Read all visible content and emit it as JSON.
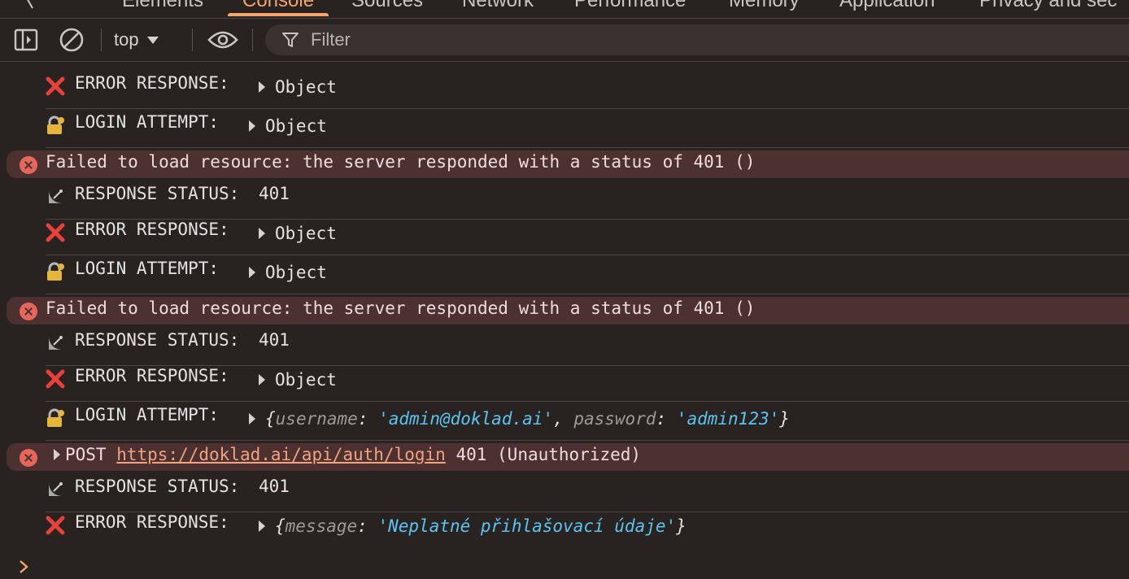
{
  "tabs": [
    {
      "label": "Elements"
    },
    {
      "label": "Console"
    },
    {
      "label": "Sources"
    },
    {
      "label": "Network"
    },
    {
      "label": "Performance"
    },
    {
      "label": "Memory"
    },
    {
      "label": "Application"
    },
    {
      "label": "Privacy and sec"
    }
  ],
  "active_tab": "Console",
  "toolbar": {
    "context": "top",
    "filter_placeholder": "Filter"
  },
  "icons": {
    "sidebar": "sidebar-toggle-icon",
    "clear": "clear-console-icon",
    "eye": "live-expression-eye-icon",
    "filter": "filter-funnel-icon",
    "error": "error-circle-x-icon",
    "cross": "cross-mark-emoji",
    "lock": "lock-with-key-emoji",
    "satellite": "satellite-dish-emoji",
    "prompt": "prompt-chevron-icon"
  },
  "colors": {
    "accent": "#f5a46e",
    "error_bg": "#4d3131",
    "number": "#9a8cf7",
    "string": "#5cc4f0"
  },
  "logs": {
    "r1": {
      "label": "ERROR RESPONSE:",
      "value": "Object"
    },
    "r2": {
      "label": "LOGIN ATTEMPT:",
      "value": "Object"
    },
    "e1": {
      "text": "Failed to load resource: the server responded with a status of 401 ()"
    },
    "r3": {
      "label": "RESPONSE STATUS:",
      "value": "401"
    },
    "r4": {
      "label": "ERROR RESPONSE:",
      "value": "Object"
    },
    "r5": {
      "label": "LOGIN ATTEMPT:",
      "value": "Object"
    },
    "e2": {
      "text": "Failed to load resource: the server responded with a status of 401 ()"
    },
    "r6": {
      "label": "RESPONSE STATUS:",
      "value": "401"
    },
    "r7": {
      "label": "ERROR RESPONSE:",
      "value": "Object"
    },
    "r8": {
      "label": "LOGIN ATTEMPT:",
      "k1": "username",
      "v1": "'admin@doklad.ai'",
      "k2": "password",
      "v2": "'admin123'"
    },
    "e3": {
      "method": "POST",
      "url": "https://doklad.ai/api/auth/login",
      "status": "401 (Unauthorized)"
    },
    "r9": {
      "label": "RESPONSE STATUS:",
      "value": "401"
    },
    "r10": {
      "label": "ERROR RESPONSE:",
      "k1": "message",
      "v1": "'Neplatné přihlašovací údaje'"
    }
  }
}
